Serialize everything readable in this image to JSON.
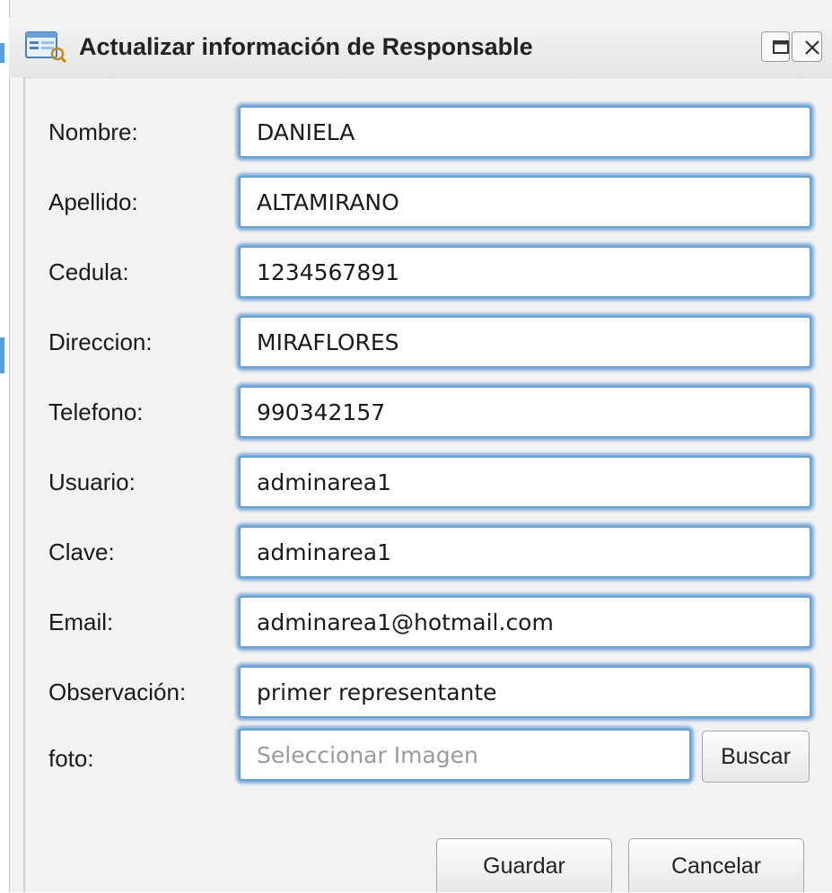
{
  "window": {
    "title": "Actualizar información de Responsable",
    "icons": {
      "title": "form-window-icon",
      "maximize": "maximize-icon",
      "close": "close-icon"
    }
  },
  "form": {
    "fields": [
      {
        "label": "Nombre:",
        "value": "DANIELA"
      },
      {
        "label": "Apellido:",
        "value": "ALTAMIRANO"
      },
      {
        "label": "Cedula:",
        "value": "1234567891"
      },
      {
        "label": "Direccion:",
        "value": "MIRAFLORES"
      },
      {
        "label": "Telefono:",
        "value": "990342157"
      },
      {
        "label": "Usuario:",
        "value": "adminarea1"
      },
      {
        "label": "Clave:",
        "value": "adminarea1"
      },
      {
        "label": "Email:",
        "value": "adminarea1@hotmail.com"
      },
      {
        "label": "Observación:",
        "value": "primer representante"
      }
    ],
    "photo": {
      "label": "foto:",
      "value": "",
      "placeholder": "Seleccionar Imagen",
      "browse_label": "Buscar"
    }
  },
  "actions": {
    "save_label": "Guardar",
    "cancel_label": "Cancelar"
  },
  "colors": {
    "focus_border": "#6a9fd0",
    "focus_glow": "#5a96d7",
    "background": "#f2f2f2"
  }
}
